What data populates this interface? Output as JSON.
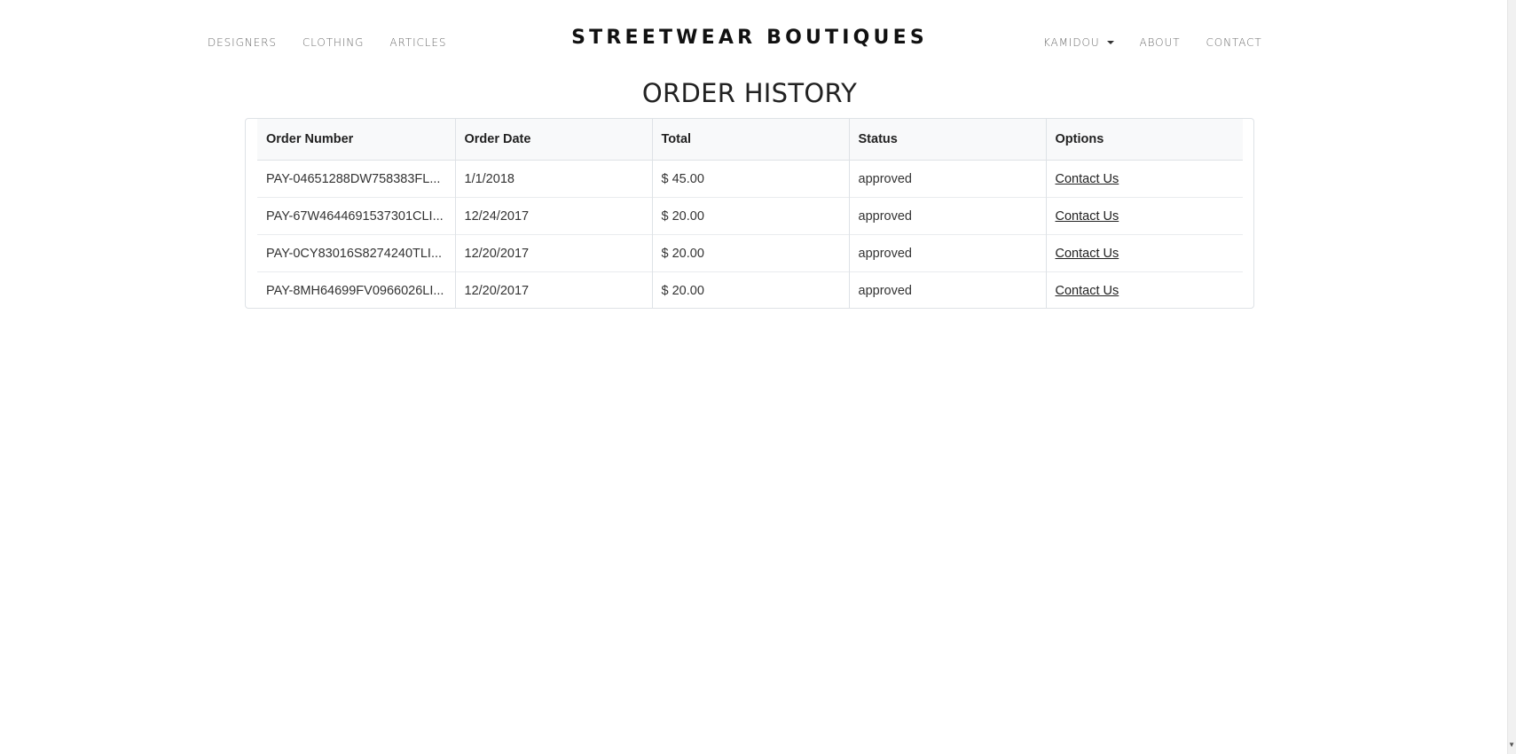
{
  "nav": {
    "left": [
      "DESIGNERS",
      "CLOTHING",
      "ARTICLES"
    ],
    "brand": "STREETWEAR BOUTIQUES",
    "user": "KAMIDOU",
    "right": [
      "ABOUT",
      "CONTACT"
    ]
  },
  "page": {
    "title": "ORDER HISTORY"
  },
  "table": {
    "headers": [
      "Order Number",
      "Order Date",
      "Total",
      "Status",
      "Options"
    ],
    "rows": [
      {
        "order_number": "PAY-04651288DW758383FL...",
        "date": "1/1/2018",
        "total": "$ 45.00",
        "status": "approved",
        "option": "Contact Us"
      },
      {
        "order_number": "PAY-67W4644691537301CLI...",
        "date": "12/24/2017",
        "total": "$ 20.00",
        "status": "approved",
        "option": "Contact Us"
      },
      {
        "order_number": "PAY-0CY83016S8274240TLI...",
        "date": "12/20/2017",
        "total": "$ 20.00",
        "status": "approved",
        "option": "Contact Us"
      },
      {
        "order_number": "PAY-8MH64699FV0966026LI...",
        "date": "12/20/2017",
        "total": "$ 20.00",
        "status": "approved",
        "option": "Contact Us"
      }
    ]
  },
  "icons": {
    "user_dropdown": "caret-down-icon",
    "scroll_down": "chevron-down-icon"
  }
}
